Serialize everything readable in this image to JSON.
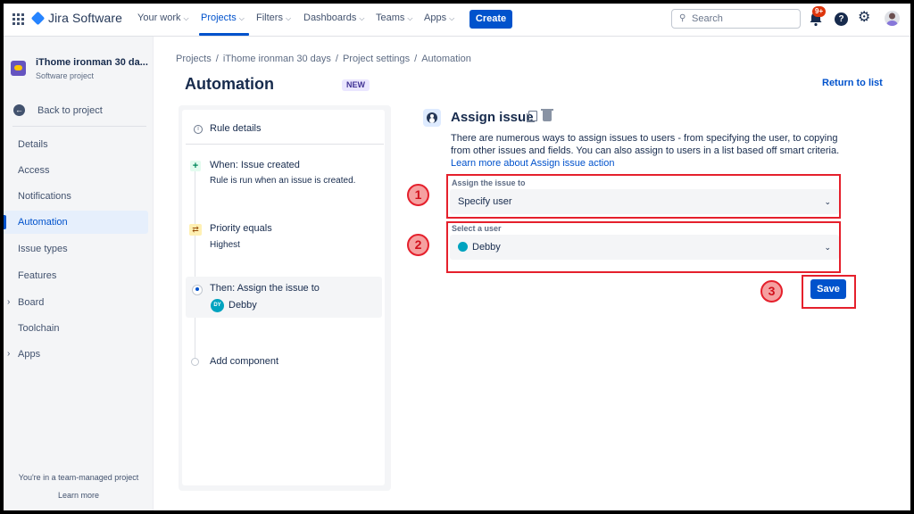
{
  "nav": {
    "product": "Jira Software",
    "items": [
      {
        "label": "Your work"
      },
      {
        "label": "Projects"
      },
      {
        "label": "Filters"
      },
      {
        "label": "Dashboards"
      },
      {
        "label": "Teams"
      },
      {
        "label": "Apps"
      }
    ],
    "create_label": "Create",
    "search_placeholder": "Search",
    "notification_badge": "9+",
    "help_glyph": "?",
    "icons": [
      "app-switcher-icon",
      "jira-logo-icon",
      "bell-icon",
      "help-icon",
      "gear-icon",
      "avatar"
    ]
  },
  "sidebar": {
    "project_name": "iThome ironman 30 da...",
    "project_type": "Software project",
    "back_label": "Back to project",
    "items": [
      {
        "label": "Details"
      },
      {
        "label": "Access"
      },
      {
        "label": "Notifications"
      },
      {
        "label": "Automation"
      },
      {
        "label": "Issue types"
      },
      {
        "label": "Features"
      },
      {
        "label": "Board"
      },
      {
        "label": "Toolchain"
      },
      {
        "label": "Apps"
      }
    ],
    "team_note": "You're in a team-managed project",
    "learn_more": "Learn more"
  },
  "main": {
    "breadcrumbs": [
      "Projects",
      "iThome ironman 30 days",
      "Project settings",
      "Automation"
    ],
    "title": "Automation",
    "new_label": "NEW",
    "return_label": "Return to list"
  },
  "rule": {
    "details_label": "Rule details",
    "trigger_title": "When: Issue created",
    "trigger_desc": "Rule is run when an issue is created.",
    "condition_title": "Priority equals",
    "condition_value": "Highest",
    "action_title": "Then: Assign the issue to",
    "action_user_initials": "DY",
    "action_user": "Debby",
    "add_component": "Add component"
  },
  "config": {
    "title": "Assign issue",
    "description": "There are numerous ways to assign issues to users - from specifying the user, to copying from other issues and fields. You can also assign to users in a list based off smart criteria.",
    "description_link": "Learn more about Assign issue action",
    "assign_label": "Assign the issue to",
    "assign_value": "Specify user",
    "user_label": "Select a user",
    "user_value": "Debby",
    "save_label": "Save"
  },
  "annotations": {
    "step1": "1",
    "step2": "2",
    "step3": "3",
    "color": "#e5202c"
  }
}
